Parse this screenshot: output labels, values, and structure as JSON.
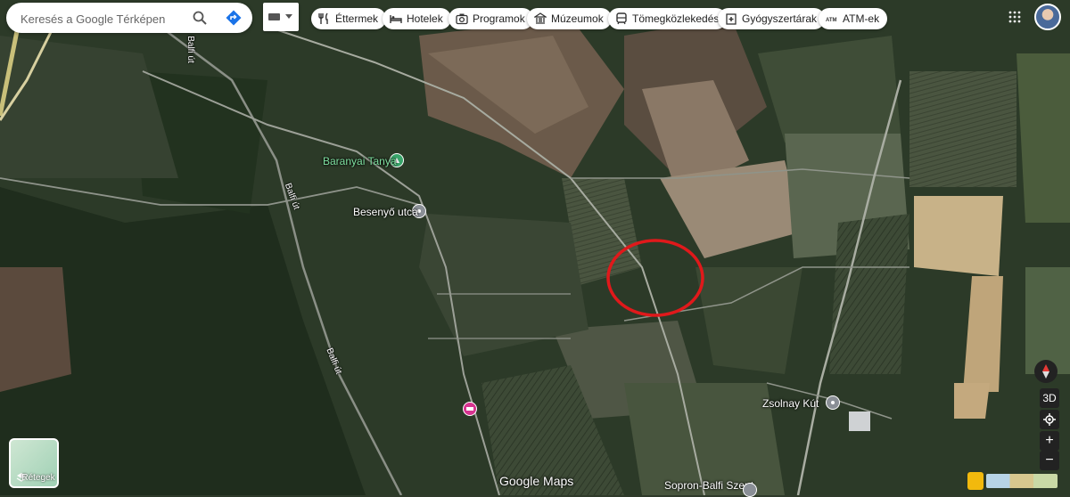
{
  "search": {
    "placeholder": "Keresés a Google Térképen"
  },
  "chips": [
    {
      "label": "Éttermek",
      "icon": "restaurant-icon"
    },
    {
      "label": "Hotelek",
      "icon": "hotel-icon"
    },
    {
      "label": "Programok",
      "icon": "camera-icon"
    },
    {
      "label": "Múzeumok",
      "icon": "museum-icon"
    },
    {
      "label": "Tömegközlekedés",
      "icon": "transit-icon"
    },
    {
      "label": "Gyógyszertárak",
      "icon": "pharmacy-icon"
    },
    {
      "label": "ATM-ek",
      "icon": "atm-icon"
    }
  ],
  "places": {
    "baranyai": "Baranyai Tanya",
    "besenyo": "Besenyő utca",
    "zsolnay": "Zsolnay Kút",
    "sopron": "Sopron-Balfi Szent"
  },
  "roads": {
    "balfi": "Balfi út"
  },
  "controls": {
    "three_d": "3D",
    "zoom_in": "+",
    "zoom_out": "−"
  },
  "layers": {
    "label": "Rétegek"
  },
  "brand": {
    "text": "Google Maps"
  },
  "colors": {
    "highlight_circle": "#e0191b",
    "place_pin": "#3aa56b",
    "poi_pin": "#d6338f"
  }
}
